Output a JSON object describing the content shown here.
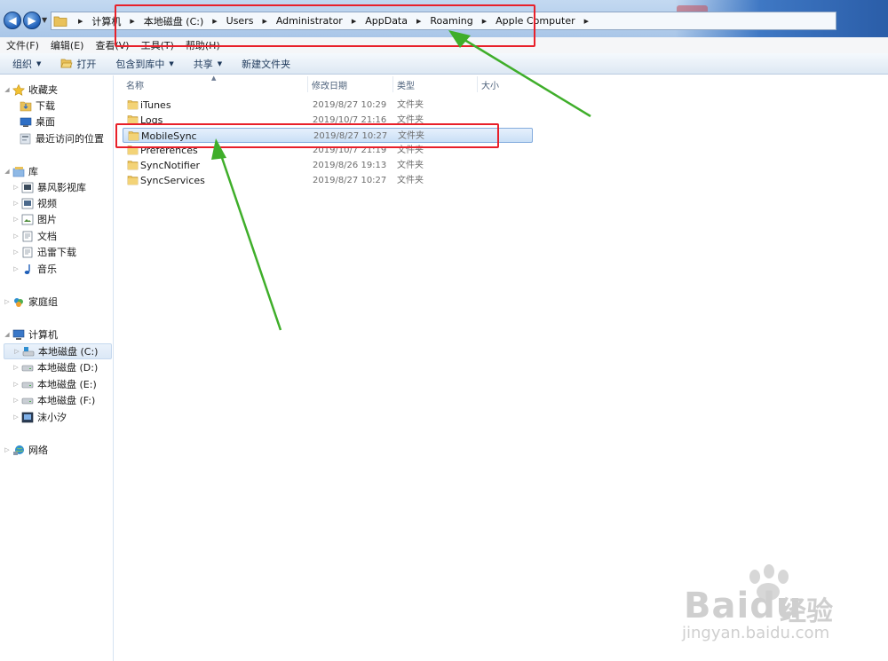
{
  "breadcrumbs": [
    "计算机",
    "本地磁盘 (C:)",
    "Users",
    "Administrator",
    "AppData",
    "Roaming",
    "Apple Computer"
  ],
  "menu": [
    "文件(F)",
    "编辑(E)",
    "查看(V)",
    "工具(T)",
    "帮助(H)"
  ],
  "commands": {
    "organize": "组织",
    "open": "打开",
    "include_in_library": "包含到库中",
    "share": "共享",
    "new_folder": "新建文件夹"
  },
  "nav": {
    "favorites": "收藏夹",
    "downloads": "下载",
    "desktop": "桌面",
    "recent": "最近访问的位置",
    "libraries": "库",
    "storm_video": "暴风影视库",
    "videos": "视频",
    "pictures": "图片",
    "documents": "文档",
    "xunlei": "迅雷下载",
    "music": "音乐",
    "homegroup": "家庭组",
    "computer": "计算机",
    "drive_c": "本地磁盘 (C:)",
    "drive_d": "本地磁盘 (D:)",
    "drive_e": "本地磁盘 (E:)",
    "drive_f": "本地磁盘 (F:)",
    "user": "沫小汐",
    "network": "网络"
  },
  "columns": {
    "name": "名称",
    "modified": "修改日期",
    "type": "类型",
    "size": "大小"
  },
  "files": [
    {
      "name": "iTunes",
      "modified": "2019/8/27 10:29",
      "type": "文件夹"
    },
    {
      "name": "Logs",
      "modified": "2019/10/7 21:16",
      "type": "文件夹"
    },
    {
      "name": "MobileSync",
      "modified": "2019/8/27 10:27",
      "type": "文件夹"
    },
    {
      "name": "Preferences",
      "modified": "2019/10/7 21:19",
      "type": "文件夹"
    },
    {
      "name": "SyncNotifier",
      "modified": "2019/8/26 19:13",
      "type": "文件夹"
    },
    {
      "name": "SyncServices",
      "modified": "2019/8/27 10:27",
      "type": "文件夹"
    }
  ],
  "watermark": {
    "brand": "Bai",
    "brand2": "du",
    "brand_cn": "经验",
    "url": "jingyan.baidu.com"
  }
}
